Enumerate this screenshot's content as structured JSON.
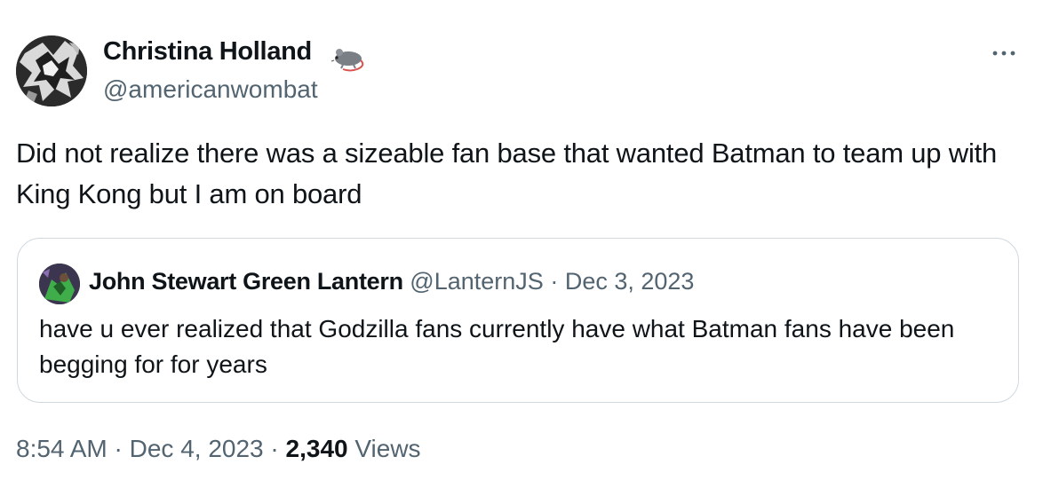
{
  "author": {
    "name": "Christina Holland",
    "handle": "@americanwombat",
    "badge_icon": "rat-emoji-icon"
  },
  "tweet": {
    "text": "Did not realize there was a sizeable fan base that wanted Batman to team up with King Kong but I am on board"
  },
  "quote": {
    "name": "John Stewart Green Lantern",
    "handle": "@LanternJS",
    "separator": "·",
    "date": "Dec 3, 2023",
    "text": "have u ever realized that Godzilla fans currently have what Batman fans have been begging for for years"
  },
  "footer": {
    "time": "8:54 AM",
    "separator": "·",
    "date": "Dec 4, 2023",
    "views_count": "2,340",
    "views_label": "Views"
  },
  "colors": {
    "text": "#0f1419",
    "secondary": "#536471",
    "border": "#cfd9de"
  }
}
